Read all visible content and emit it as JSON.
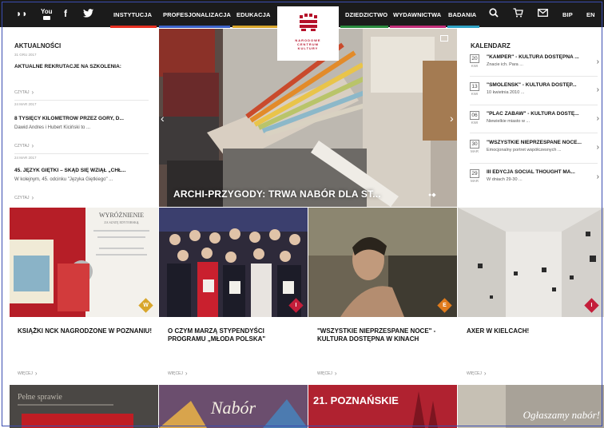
{
  "nav": {
    "left_items": [
      "INSTYTUCJA",
      "PROFESJONALIZACJA",
      "EDUKACJA"
    ],
    "right_items": [
      "DZIEDZICTWO",
      "WYDAWNICTWA",
      "BADANIA"
    ],
    "bip": "BIP",
    "lang": "EN",
    "youtube_label": "You",
    "colors": {
      "instytucja": "#e63022",
      "profesjonalizacja": "#3d63c9",
      "edukacja": "#d8a62b",
      "dziedzictwo": "#2a8b3e",
      "wydawnictwa": "#c42f7a",
      "badania": "#2fa3c5"
    }
  },
  "logo": {
    "lines": [
      "NARODOWE",
      "CENTRUM",
      "KULTURY"
    ],
    "color": "#b5112a"
  },
  "news": {
    "title": "AKTUALNOŚCI",
    "items": [
      {
        "date": "31 GRU 2017",
        "headline": "AKTUALNE REKRUTACJE NA SZKOLENIA:",
        "text": "",
        "more": "CZYTAJ"
      },
      {
        "date": "24 MAR 2017",
        "headline": "8 TYSIĘCY KILOMETRÓW PRZEZ GÓRY, D...",
        "text": "Dawid Andres i Hubert Kiciński to ...",
        "more": "CZYTAJ"
      },
      {
        "date": "24 MAR 2017",
        "headline": "45. JĘZYK GIĘTKI – SKĄD SIĘ WZIĄŁ „CHŁ...",
        "text": "W kolejnym, 45. odcinku \"Języka Giętkiego\" ...",
        "more": "CZYTAJ"
      }
    ]
  },
  "calendar": {
    "title": "KALENDARZ",
    "items": [
      {
        "day": "20",
        "month": "KWI",
        "title": "\"KAMPER\" - KULTURA DOSTĘPNA ...",
        "sub": "Znacie ich. Para ..."
      },
      {
        "day": "13",
        "month": "KWI",
        "title": "\"SMOLEŃSK\" - KULTURA DOSTĘP...",
        "sub": "10 kwietnia 2010 ..."
      },
      {
        "day": "06",
        "month": "KWI",
        "title": "\"PLAC ZABAW\" - KULTURA DOSTĘ...",
        "sub": "Niewielkie miasto w ..."
      },
      {
        "day": "30",
        "month": "MAR",
        "title": "\"WSZYSTKIE NIEPRZESPANE NOCE...",
        "sub": "Emocjonalny portret współczesnych ..."
      },
      {
        "day": "29",
        "month": "MAR",
        "title": "III EDYCJA SOCIAL THOUGHT MA...",
        "sub": "W dniach 29-30 ..."
      }
    ]
  },
  "hero": {
    "caption": "ARCHI-PRZYGODY: TRWA NABÓR DLA ST...",
    "dots": "●◆"
  },
  "cards": [
    {
      "title": "KSIĄŻKI NCK NAGRODZONE W POZNANIU!",
      "badge": "W",
      "badge_color": "#d8a62b",
      "more": "WIĘCEJ",
      "img_text": "WYRÓŻNIENIE",
      "img_sub": "ZA SZATĘ EDYTORSKĄ"
    },
    {
      "title": "O CZYM MARZĄ STYPENDYŚCI PROGRAMU „MŁODA POLSKA\"",
      "badge": "I",
      "badge_color": "#c41e3a",
      "more": "WIĘCEJ"
    },
    {
      "title": "\"WSZYSTKIE NIEPRZESPANE NOCE\" - KULTURA DOSTĘPNA W KINACH",
      "badge": "E",
      "badge_color": "#e07b1c",
      "more": "WIĘCEJ"
    },
    {
      "title": "AXER W KIELCACH!",
      "badge": "I",
      "badge_color": "#c41e3a",
      "more": "WIĘCEJ"
    }
  ],
  "bottom_tiles": [
    {
      "text": "Pełne sprawie"
    },
    {
      "text": "Nabór"
    },
    {
      "text": "21. POZNAŃSKIE"
    },
    {
      "text": "Ogłaszamy nabór!"
    }
  ]
}
